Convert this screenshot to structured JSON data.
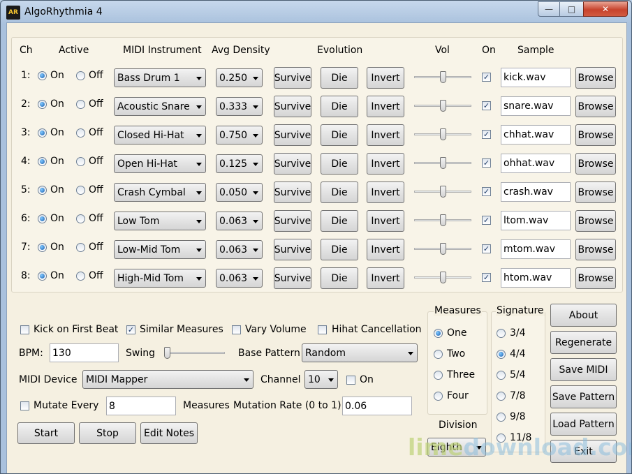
{
  "window": {
    "title": "AlgoRhythmia 4",
    "icon_text": "AR",
    "minimize_glyph": "—",
    "maximize_glyph": "□",
    "close_glyph": "✕"
  },
  "channels_header": {
    "ch": "Ch",
    "active": "Active",
    "instrument": "MIDI Instrument",
    "density": "Avg Density",
    "evolution": "Evolution",
    "vol": "Vol",
    "on": "On",
    "sample": "Sample"
  },
  "row_labels": {
    "on_label": "On",
    "off_label": "Off",
    "survive": "Survive",
    "die": "Die",
    "invert": "Invert",
    "browse": "Browse"
  },
  "channels": [
    {
      "num": "1:",
      "active": true,
      "instrument": "Bass Drum 1",
      "density": "0.250",
      "vol": 0.5,
      "on": true,
      "sample": "kick.wav"
    },
    {
      "num": "2:",
      "active": true,
      "instrument": "Acoustic Snare",
      "density": "0.333",
      "vol": 0.5,
      "on": true,
      "sample": "snare.wav"
    },
    {
      "num": "3:",
      "active": true,
      "instrument": "Closed Hi-Hat",
      "density": "0.750",
      "vol": 0.5,
      "on": true,
      "sample": "chhat.wav"
    },
    {
      "num": "4:",
      "active": true,
      "instrument": "Open Hi-Hat",
      "density": "0.125",
      "vol": 0.5,
      "on": true,
      "sample": "ohhat.wav"
    },
    {
      "num": "5:",
      "active": true,
      "instrument": "Crash Cymbal",
      "density": "0.050",
      "vol": 0.5,
      "on": true,
      "sample": "crash.wav"
    },
    {
      "num": "6:",
      "active": true,
      "instrument": "Low Tom",
      "density": "0.063",
      "vol": 0.5,
      "on": true,
      "sample": "ltom.wav"
    },
    {
      "num": "7:",
      "active": true,
      "instrument": "Low-Mid Tom",
      "density": "0.063",
      "vol": 0.5,
      "on": true,
      "sample": "mtom.wav"
    },
    {
      "num": "8:",
      "active": true,
      "instrument": "High-Mid Tom",
      "density": "0.063",
      "vol": 0.5,
      "on": true,
      "sample": "htom.wav"
    }
  ],
  "options": {
    "kick_first_beat": {
      "label": "Kick on First Beat",
      "checked": false
    },
    "similar_measures": {
      "label": "Similar Measures",
      "checked": true
    },
    "vary_volume": {
      "label": "Vary Volume",
      "checked": false
    },
    "hihat_cancellation": {
      "label": "Hihat Cancellation",
      "checked": false
    },
    "bpm_label": "BPM:",
    "bpm_value": "130",
    "swing_label": "Swing",
    "swing_value": 0.0,
    "base_pattern_label": "Base Pattern",
    "base_pattern_value": "Random",
    "midi_device_label": "MIDI Device",
    "midi_device_value": "MIDI Mapper",
    "channel_label": "Channel",
    "channel_value": "10",
    "channel_on_label": "On",
    "channel_on_checked": false,
    "mutate_every_label": "Mutate Every",
    "mutate_every_checked": false,
    "mutate_every_value": "8",
    "measures_label": "Measures",
    "mutation_rate_label": "Mutation Rate (0 to 1)",
    "mutation_rate_value": "0.06"
  },
  "transport": {
    "start": "Start",
    "stop": "Stop",
    "edit_notes": "Edit Notes"
  },
  "measures": {
    "title": "Measures",
    "items": [
      {
        "label": "One",
        "selected": true
      },
      {
        "label": "Two",
        "selected": false
      },
      {
        "label": "Three",
        "selected": false
      },
      {
        "label": "Four",
        "selected": false
      }
    ]
  },
  "division": {
    "title": "Division",
    "value": "Eighth"
  },
  "signature": {
    "title": "Signature",
    "items": [
      {
        "label": "3/4",
        "selected": false
      },
      {
        "label": "4/4",
        "selected": true
      },
      {
        "label": "5/4",
        "selected": false
      },
      {
        "label": "7/8",
        "selected": false
      },
      {
        "label": "9/8",
        "selected": false
      },
      {
        "label": "11/8",
        "selected": false
      }
    ]
  },
  "actions": {
    "about": "About",
    "regenerate": "Regenerate",
    "save_midi": "Save MIDI",
    "save_pattern": "Save Pattern",
    "load_pattern": "Load Pattern",
    "exit": "Exit"
  },
  "watermark": {
    "part1": "lime",
    "part2": "download.com"
  },
  "check_glyph": "✓"
}
